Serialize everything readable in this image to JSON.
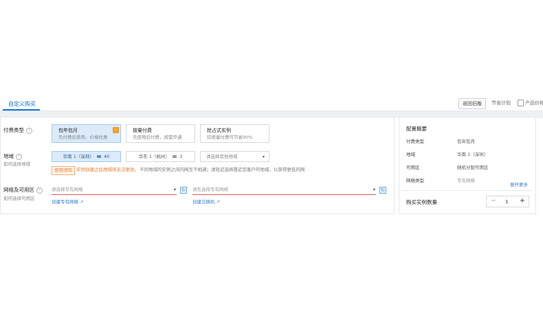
{
  "header": {
    "active_tab": "自定义购买",
    "back_button": "返回旧版",
    "saving_link": "节省计划",
    "price_link": "产品价格"
  },
  "billing": {
    "label": "付费类型",
    "options": [
      {
        "title": "包年包月",
        "desc": "先付费后使用，价格优惠",
        "selected": true
      },
      {
        "title": "按量付费",
        "desc": "先使用后付费，按需开通",
        "selected": false
      },
      {
        "title": "抢占式实例",
        "desc": "较按量付费可节省90%",
        "selected": false
      }
    ],
    "check_mark": "✓"
  },
  "region": {
    "label": "地域",
    "sublabel": "如何选择地域",
    "options": [
      {
        "name": "华南 1（深圳）",
        "count": "40",
        "selected": true
      },
      {
        "name": "华东 1（杭州）",
        "count": "3",
        "selected": false
      }
    ],
    "other_placeholder": "请选择其他地域",
    "tip_tag": "使用须知",
    "tip_warning": "实例创建之后地域将无法更改。",
    "tip_detail": "不同地域的实例之间内网互不相通；请就近选择靠近您客户的地域，以获得更低的网络时延、更快的访问速度。"
  },
  "network": {
    "label": "网络及可用区",
    "sublabel": "如何选择可用区",
    "vpc_placeholder": "请选择专有网络",
    "vswitch_placeholder": "请先选择专有网络",
    "create_vpc": "创建专有网络",
    "create_vswitch": "创建交换机",
    "refresh_icon": "↻"
  },
  "summary": {
    "title": "配置概要",
    "items": [
      {
        "key": "付费类型",
        "value": "包年包月"
      },
      {
        "key": "地域",
        "value": "华南 1（深圳）"
      },
      {
        "key": "可用区",
        "value": "随机分配可用区"
      },
      {
        "key": "网络类型",
        "value": "专有网络"
      }
    ],
    "expand_link": "展开更多",
    "quantity_label": "购买实例数量",
    "quantity": "1",
    "minus": "−",
    "plus": "+"
  }
}
